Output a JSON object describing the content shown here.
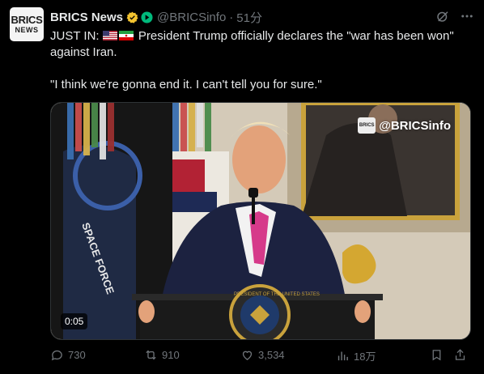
{
  "account": {
    "avatar_top": "BRICS",
    "avatar_bottom": "NEWS",
    "name": "BRICS News",
    "handle": "@BRICSinfo",
    "separator": "·",
    "time": "51分"
  },
  "post": {
    "line1_prefix": "JUST IN:",
    "line1_suffix": "President Trump officially declares the \"war has been won\"",
    "line2": "against Iran.",
    "quote": "\"I think we're gonna end it. I can't tell you for sure.\""
  },
  "media": {
    "watermark": "@BRICSinfo",
    "duration": "0:05",
    "flag_text": "SPACE FORCE",
    "seal_text": "PRESIDENT OF THE UNITED STATES"
  },
  "actions": {
    "replies": "730",
    "reposts": "910",
    "likes": "3,534",
    "views": "18万"
  },
  "colors": {
    "background": "#000000",
    "text": "#e7e9ea",
    "muted": "#71767b",
    "verified": "#f4c430",
    "accent_green": "#00ba7c"
  }
}
